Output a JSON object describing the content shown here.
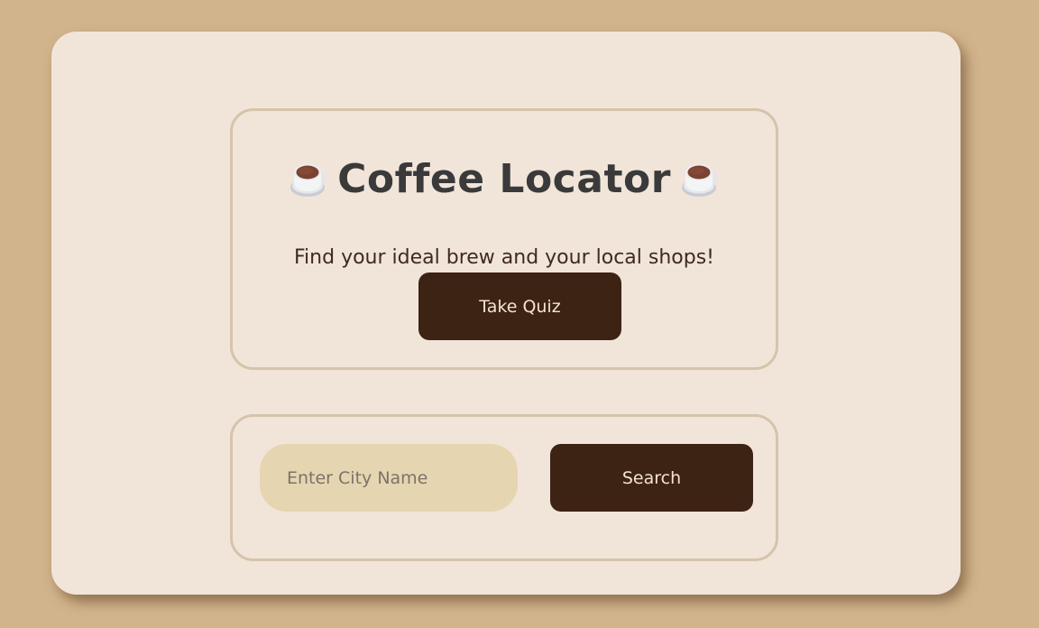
{
  "hero": {
    "title": "Coffee Locator",
    "tagline": "Find your ideal brew and your local shops!",
    "quiz_button": "Take Quiz",
    "left_icon": "coffee-cup-icon",
    "right_icon": "coffee-cup-icon"
  },
  "search": {
    "value": "",
    "placeholder": "Enter City Name",
    "button_label": "Search"
  },
  "colors": {
    "page_background": "#d2b48c",
    "card_background": "#f1e5da",
    "button_background": "#3d2314",
    "button_text": "#f3e3cc",
    "input_background": "#e6d5b1",
    "panel_border": "#d5c4aa"
  }
}
